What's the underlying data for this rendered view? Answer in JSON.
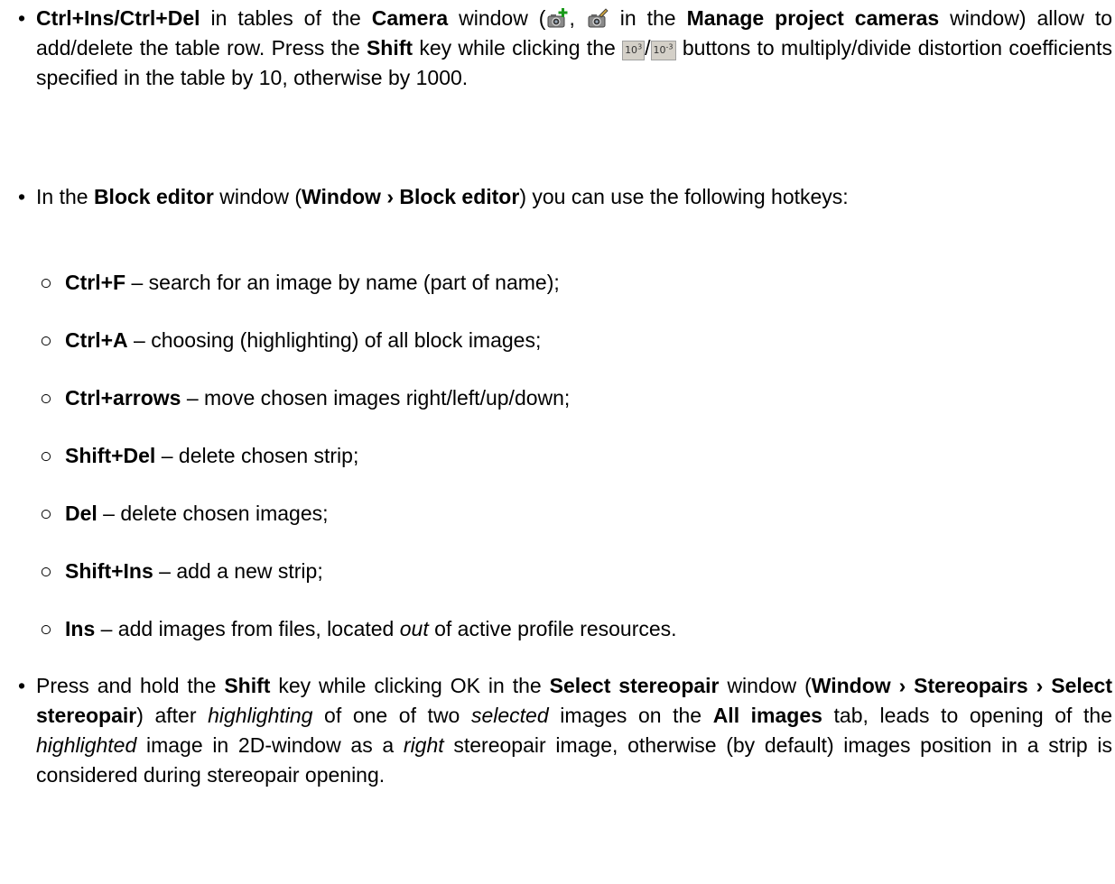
{
  "bullets": {
    "b1": {
      "k1": "Ctrl+Ins",
      "t1": "/",
      "k2": "Ctrl+Del",
      "t2": " in tables of the ",
      "w1": "Camera",
      "t3": " window (",
      "t4": ", ",
      "t5": " in the ",
      "w2": "Manage project cameras",
      "t6": " window) allow to add/delete the table row. Press the ",
      "k3": "Shift",
      "t7": " key while clicking the ",
      "btn1": "10",
      "btn1_exp": "3",
      "t8": "/",
      "btn2": "10",
      "btn2_exp": "-3",
      "t9": " buttons to multiply/divide distortion coefficients specified in the table by 10, otherwise by 1000."
    },
    "b2": {
      "t1": "In the ",
      "w1": "Block editor",
      "t2": " window (",
      "w2": "Window › Block editor",
      "t3": ") you can use the following hotkeys:"
    },
    "subs": [
      {
        "key": "Ctrl+F",
        "text": " – search for an image by name (part of name);"
      },
      {
        "key": "Ctrl+A",
        "text": " – choosing (highlighting) of all block images;"
      },
      {
        "key": "Ctrl+arrows",
        "text": " – move chosen images right/left/up/down;"
      },
      {
        "key": "Shift+Del",
        "text": " – delete chosen strip;"
      },
      {
        "key": "Del",
        "text": " – delete chosen images;"
      },
      {
        "key": "Shift+Ins",
        "text": " – add a new strip;"
      },
      {
        "key": "Ins",
        "text": " – add images from files, located ",
        "em": "out",
        "tail": " of active profile resources."
      }
    ],
    "b3": {
      "t1": "Press and hold the ",
      "k1": "Shift",
      "t2": " key while clicking OK in the ",
      "w1": "Select stereopair",
      "t3": " window (",
      "w2": "Window › Stereopairs › Select stereopair",
      "t4": ") after ",
      "e1": "highlighting",
      "t5": " of one of two ",
      "e2": "selected",
      "t6": " images on the ",
      "w3": "All images",
      "t7": " tab, leads to opening of the ",
      "e3": "highlighted",
      "t8": " image in 2D-window as a ",
      "e4": "right",
      "t9": " stereopair image, otherwise (by default) images position in a strip is considered during stereopair opening."
    }
  },
  "markers": {
    "bullet": "•",
    "circle": "○"
  },
  "icons": [
    "camera-add-icon",
    "camera-edit-icon"
  ]
}
